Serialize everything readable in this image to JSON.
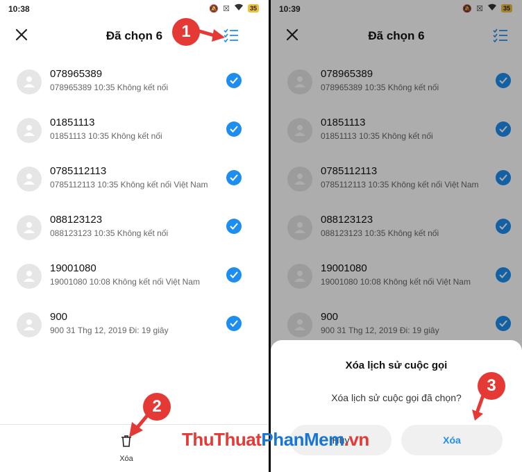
{
  "left": {
    "status": {
      "time": "10:38",
      "battery": "35"
    },
    "title": "Đã chọn 6",
    "items": [
      {
        "number": "078965389",
        "detail": "078965389  10:35 Không kết nối"
      },
      {
        "number": "01851113",
        "detail": "01851113  10:35 Không kết nối"
      },
      {
        "number": "0785112113",
        "detail": "0785112113  10:35 Không kết nối  Việt Nam"
      },
      {
        "number": "088123123",
        "detail": "088123123  10:35 Không kết nối"
      },
      {
        "number": "19001080",
        "detail": "19001080  10:08 Không kết nối  Việt Nam"
      },
      {
        "number": "900",
        "detail": "900  31 Thg 12, 2019 Đi: 19 giây"
      }
    ],
    "delete_label": "Xóa"
  },
  "right": {
    "status": {
      "time": "10:39",
      "battery": "35"
    },
    "title": "Đã chọn 6",
    "items": [
      {
        "number": "078965389",
        "detail": "078965389  10:35 Không kết nối"
      },
      {
        "number": "01851113",
        "detail": "01851113  10:35 Không kết nối"
      },
      {
        "number": "0785112113",
        "detail": "0785112113  10:35 Không kết nối  Việt Nam"
      },
      {
        "number": "088123123",
        "detail": "088123123  10:35 Không kết nối"
      },
      {
        "number": "19001080",
        "detail": "19001080  10:08 Không kết nối  Việt Nam"
      },
      {
        "number": "900",
        "detail": "900  31 Thg 12, 2019 Đi: 19 giây"
      }
    ],
    "dialog": {
      "title": "Xóa lịch sử cuộc gọi",
      "message": "Xóa lịch sử cuộc gọi đã chọn?",
      "cancel_label": "Hủy",
      "confirm_label": "Xóa"
    }
  },
  "markers": [
    "1",
    "2",
    "3"
  ],
  "watermark": {
    "part1": "ThuThuat",
    "part2": "PhanMem",
    "part3": ".vn"
  },
  "colors": {
    "accent": "#1d8ef0",
    "marker": "#e53935"
  }
}
